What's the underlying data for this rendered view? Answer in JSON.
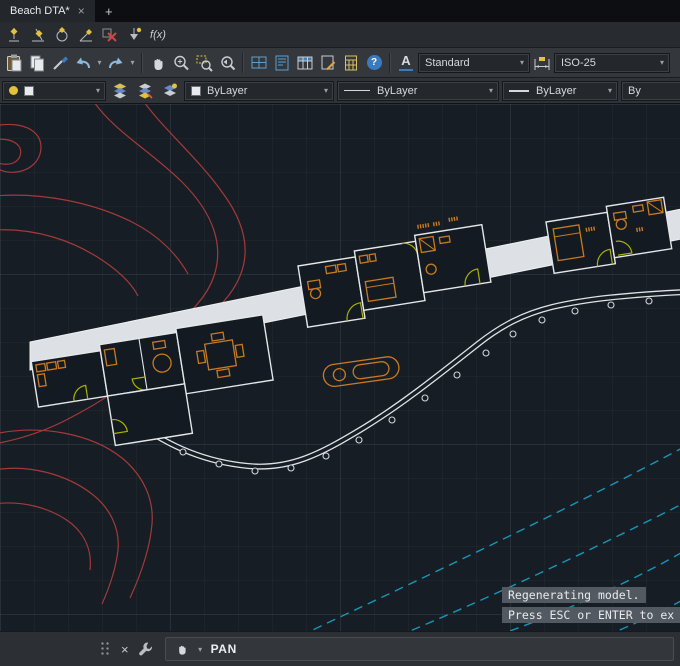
{
  "theme": {
    "canvas_bg": "#171d24",
    "contour_red": "#a33a3a",
    "water_cyan": "#1796b4",
    "fixture_orange": "#c97a20",
    "door_yellow": "#a9b400",
    "wall_white": "#e4e7ea"
  },
  "tab_bar": {
    "active_tab_title": "Beach DTA*",
    "tab_close_glyph": "×",
    "new_tab_glyph": "+"
  },
  "toolbars": {
    "text_style_combo_value": "Standard",
    "dim_style_combo_value": "ISO-25",
    "color_combo_value": "ByLayer",
    "linetype_combo_value": "ByLayer",
    "lineweight_combo_value": "ByLayer",
    "plot_style_combo_value": "By",
    "fx_icon_label": "f(x)",
    "help_icon_glyph": "?",
    "text_style_icon_glyph": "A",
    "chevron_glyph": "▾"
  },
  "command_area": {
    "history_line_1": "Regenerating model.",
    "history_line_2": "Press ESC or ENTER to ex",
    "active_command": "PAN",
    "close_glyph": "×"
  }
}
